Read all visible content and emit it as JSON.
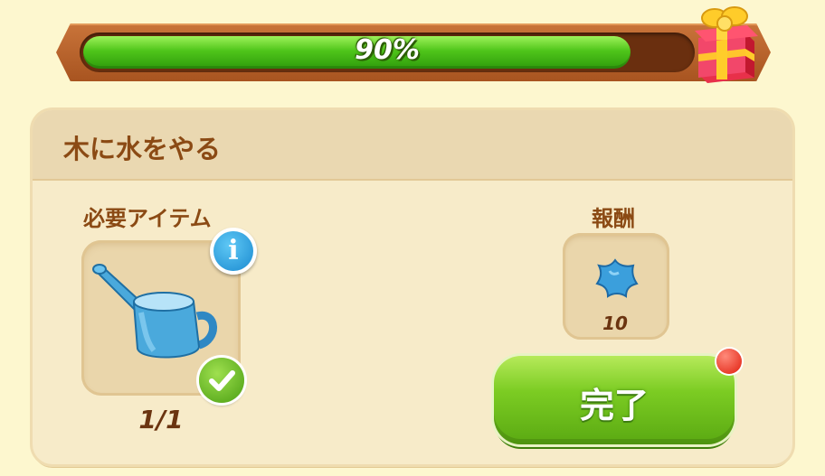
{
  "progress": {
    "percent_label": "90%",
    "fraction": 0.9
  },
  "quest": {
    "title": "木に水をやる",
    "required_label": "必要アイテム",
    "required_item_icon": "watering-can-icon",
    "required_count": "1/1",
    "reward_label": "報酬",
    "reward_icon": "blue-star-icon",
    "reward_amount": "10",
    "complete_button": "完了"
  },
  "colors": {
    "progress_green": "#4fc51a",
    "title_brown": "#8b4a14",
    "button_green": "#7ccc23"
  }
}
